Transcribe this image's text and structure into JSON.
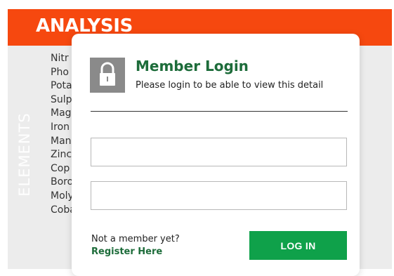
{
  "background": {
    "header_title": "ANALYSIS",
    "side_label": "ELEMENTS",
    "elements": [
      "Nitr",
      "Pho",
      "Pota",
      "Sulp",
      "Mag",
      "Iron",
      "Man",
      "Zinc",
      "Cop",
      "Boro",
      "Moly",
      "Coba"
    ],
    "colors": {
      "header": "#f6480f",
      "panel": "#ececec"
    }
  },
  "modal": {
    "title": "Member Login",
    "subtitle": "Please login to be able to view this detail",
    "lock_icon": "lock-icon",
    "fields": [
      {
        "value": "",
        "placeholder": ""
      },
      {
        "value": "",
        "placeholder": ""
      }
    ],
    "footer": {
      "prompt": "Not a member yet?",
      "register_label": "Register Here"
    },
    "login_button_label": "LOG IN",
    "colors": {
      "title": "#1d6c3a",
      "button": "#0fa14a"
    }
  }
}
